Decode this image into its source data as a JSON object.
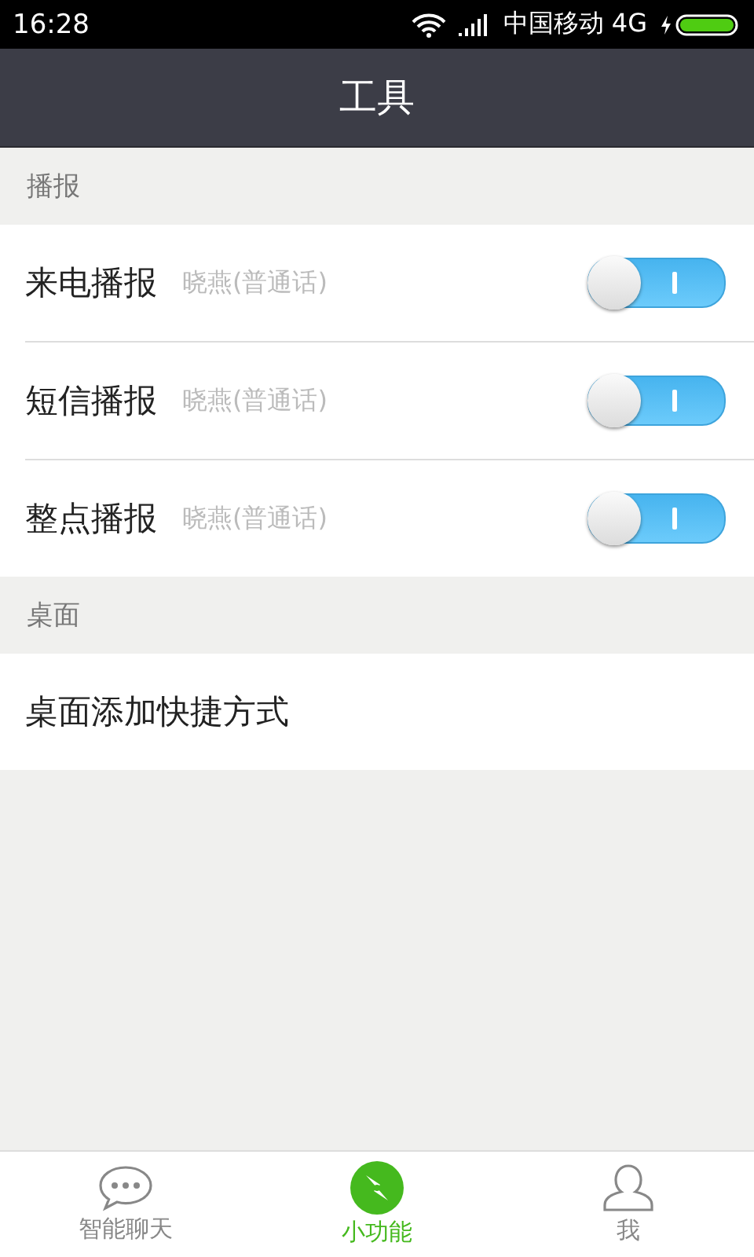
{
  "status_bar": {
    "time": "16:28",
    "carrier": "中国移动 4G"
  },
  "header": {
    "title": "工具"
  },
  "sections": [
    {
      "title": "播报",
      "rows": [
        {
          "kind": "toggle",
          "label": "来电播报",
          "detail": "晓燕(普通话)",
          "on": false
        },
        {
          "kind": "toggle",
          "label": "短信播报",
          "detail": "晓燕(普通话)",
          "on": false
        },
        {
          "kind": "toggle",
          "label": "整点播报",
          "detail": "晓燕(普通话)",
          "on": false
        }
      ]
    },
    {
      "title": "桌面",
      "rows": [
        {
          "kind": "link",
          "label": "桌面添加快捷方式"
        }
      ]
    }
  ],
  "tabs": [
    {
      "label": "智能聊天",
      "selected": false
    },
    {
      "label": "小功能",
      "selected": true
    },
    {
      "label": "我",
      "selected": false
    }
  ]
}
